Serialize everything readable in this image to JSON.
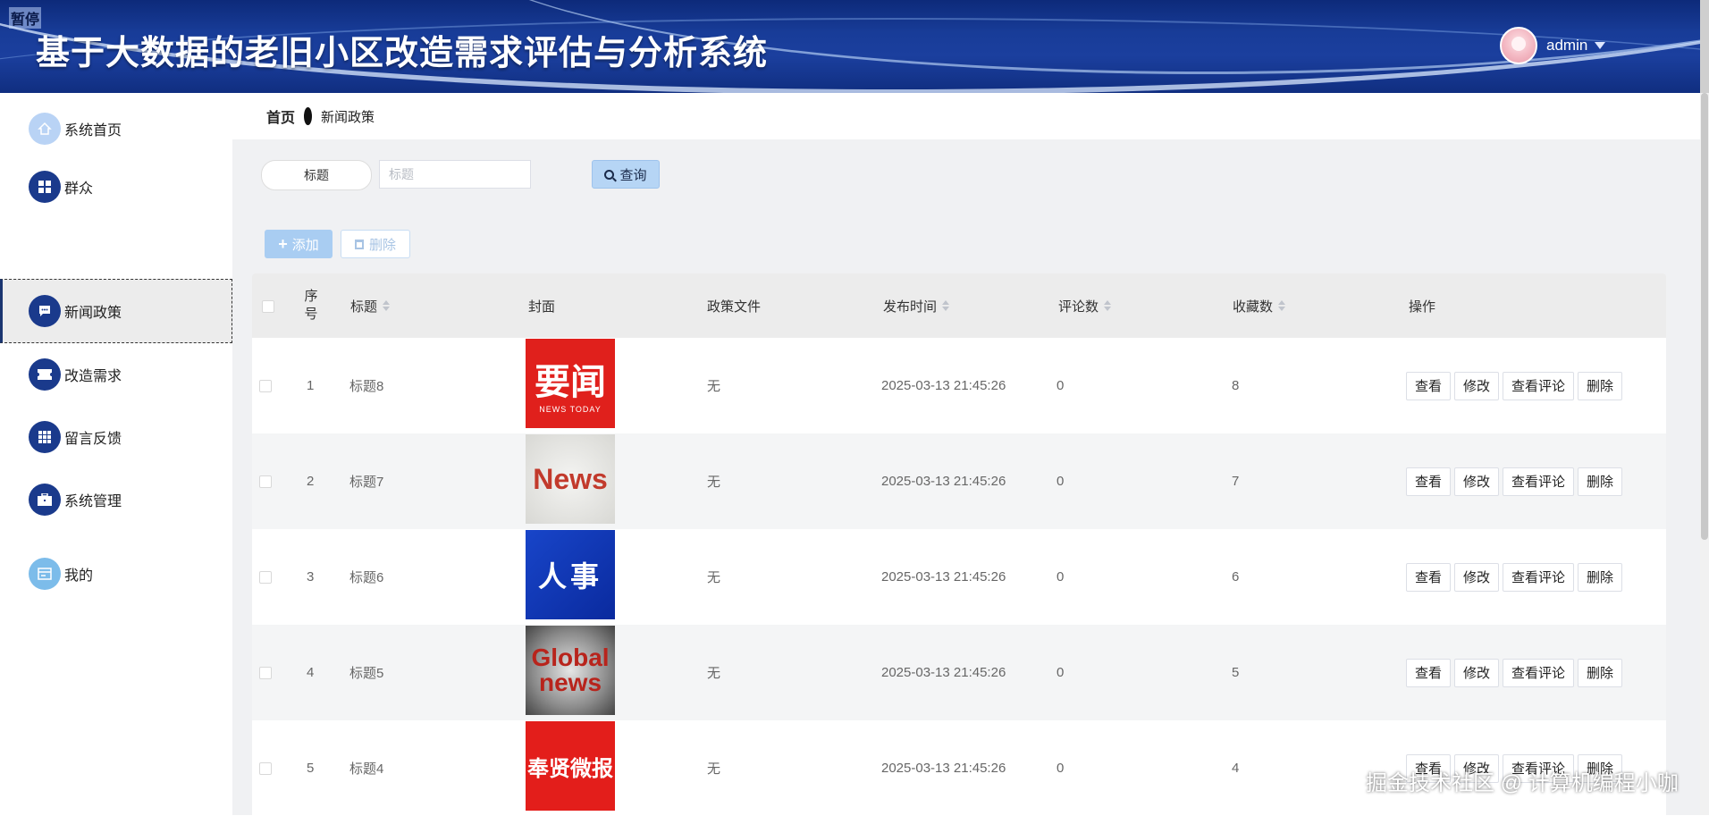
{
  "header": {
    "tag": "暂停",
    "title": "基于大数据的老旧小区改造需求评估与分析系统",
    "user": {
      "name": "admin"
    }
  },
  "breadcrumb": {
    "home": "首页",
    "current": "新闻政策"
  },
  "sidebar": {
    "items": [
      {
        "label": "系统首页",
        "icon": "home-icon",
        "active": false
      },
      {
        "label": "群众",
        "icon": "grid-icon",
        "active": false
      },
      {
        "label": "新闻政策",
        "icon": "chat-icon",
        "active": true
      },
      {
        "label": "改造需求",
        "icon": "ticket-icon",
        "active": false
      },
      {
        "label": "留言反馈",
        "icon": "apps-icon",
        "active": false
      },
      {
        "label": "系统管理",
        "icon": "briefcase-icon",
        "active": false
      },
      {
        "label": "我的",
        "icon": "card-icon",
        "active": false
      }
    ]
  },
  "search": {
    "label": "标题",
    "placeholder": "标题",
    "button": "查询"
  },
  "actions": {
    "add": "添加",
    "delete": "删除"
  },
  "table": {
    "columns": {
      "index": "序号",
      "title": "标题",
      "cover": "封面",
      "file": "政策文件",
      "time": "发布时间",
      "comments": "评论数",
      "favorites": "收藏数",
      "ops": "操作"
    },
    "rows": [
      {
        "index": "1",
        "title": "标题8",
        "cover": {
          "big": "要闻",
          "small": "NEWS TODAY"
        },
        "file": "无",
        "time": "2025-03-13 21:45:26",
        "comments": "0",
        "favorites": "8"
      },
      {
        "index": "2",
        "title": "标题7",
        "cover": {
          "big": "News",
          "small": ""
        },
        "file": "无",
        "time": "2025-03-13 21:45:26",
        "comments": "0",
        "favorites": "7"
      },
      {
        "index": "3",
        "title": "标题6",
        "cover": {
          "big": "人事",
          "small": ""
        },
        "file": "无",
        "time": "2025-03-13 21:45:26",
        "comments": "0",
        "favorites": "6"
      },
      {
        "index": "4",
        "title": "标题5",
        "cover": {
          "big": "Global news",
          "small": ""
        },
        "file": "无",
        "time": "2025-03-13 21:45:26",
        "comments": "0",
        "favorites": "5"
      },
      {
        "index": "5",
        "title": "标题4",
        "cover": {
          "big": "奉贤微报",
          "small": ""
        },
        "file": "无",
        "time": "2025-03-13 21:45:26",
        "comments": "0",
        "favorites": "4"
      }
    ],
    "row_ops": {
      "view": "查看",
      "edit": "修改",
      "comments": "查看评论",
      "delete": "删除"
    }
  },
  "watermark": "掘金技术社区 @ 计算机编程小咖",
  "colors": {
    "header": "#183c98",
    "accent": "#1a3a8c",
    "button_light": "#b6d5f5"
  }
}
